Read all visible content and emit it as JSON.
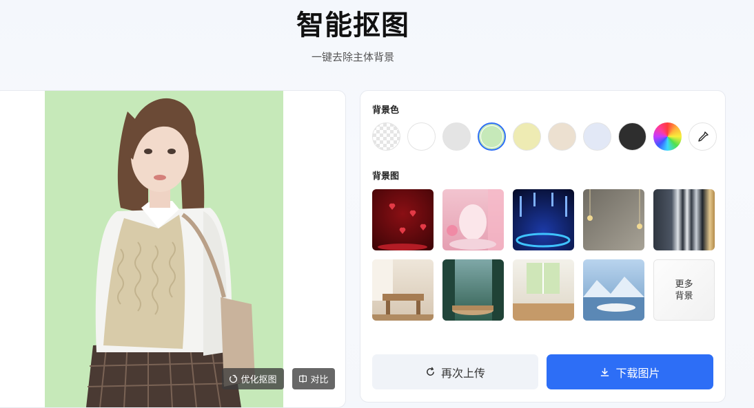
{
  "header": {
    "title": "智能抠图",
    "subtitle": "一键去除主体背景"
  },
  "preview": {
    "background_color": "#c6e9b9",
    "optimize_label": "优化抠图",
    "compare_label": "对比"
  },
  "settings": {
    "bg_color_label": "背景色",
    "bg_image_label": "背景图",
    "colors": [
      {
        "name": "transparent",
        "value": "transparent"
      },
      {
        "name": "white",
        "value": "#ffffff"
      },
      {
        "name": "light-gray",
        "value": "#e4e4e4"
      },
      {
        "name": "light-green",
        "value": "#c6e9b9",
        "selected": true
      },
      {
        "name": "light-yellow",
        "value": "#eeebb3"
      },
      {
        "name": "beige",
        "value": "#ece0d0"
      },
      {
        "name": "light-blue",
        "value": "#e2e8f6"
      },
      {
        "name": "black",
        "value": "#2e2e2e"
      },
      {
        "name": "rainbow",
        "value": "multicolor"
      },
      {
        "name": "eyedropper",
        "value": "picker"
      }
    ],
    "more_label": "更多背景",
    "reupload_label": "再次上传",
    "download_label": "下载图片"
  },
  "theme": {
    "accent": "#2d6ef6"
  }
}
